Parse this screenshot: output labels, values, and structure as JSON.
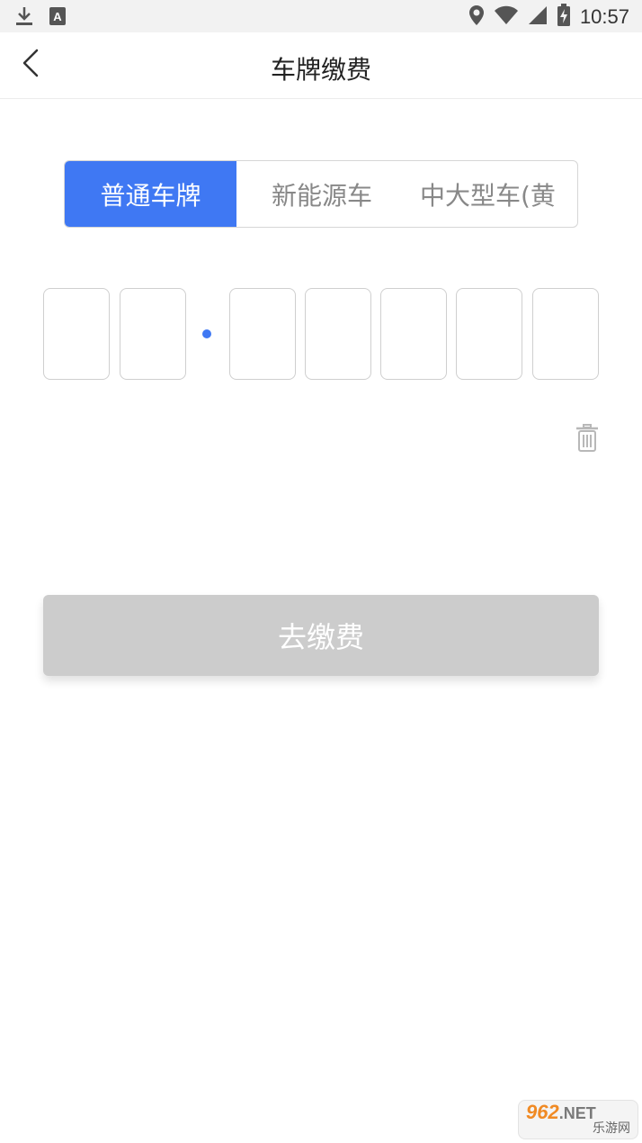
{
  "status_bar": {
    "time": "10:57",
    "left_icons": [
      "download-icon",
      "a-icon"
    ],
    "right_icons": [
      "location-icon",
      "wifi-icon",
      "signal-icon",
      "battery-charging-icon"
    ]
  },
  "nav": {
    "title": "车牌缴费",
    "back_icon": "chevron-left-icon"
  },
  "plate_tabs": [
    {
      "label": "普通车牌",
      "selected": true
    },
    {
      "label": "新能源车",
      "selected": false
    },
    {
      "label": "中大型车(黄",
      "selected": false
    }
  ],
  "plate_input": {
    "boxes": [
      "",
      "",
      "",
      "",
      "",
      "",
      ""
    ],
    "separator": "dot"
  },
  "actions": {
    "clear_icon": "trash-icon",
    "pay_label": "去缴费"
  },
  "watermark": {
    "logo_text": "962",
    "logo_suffix": ".NET",
    "sub_text": "乐游网"
  },
  "colors": {
    "accent": "#3f78f3",
    "button_disabled": "#cccccc",
    "border": "#cfcfcf"
  }
}
